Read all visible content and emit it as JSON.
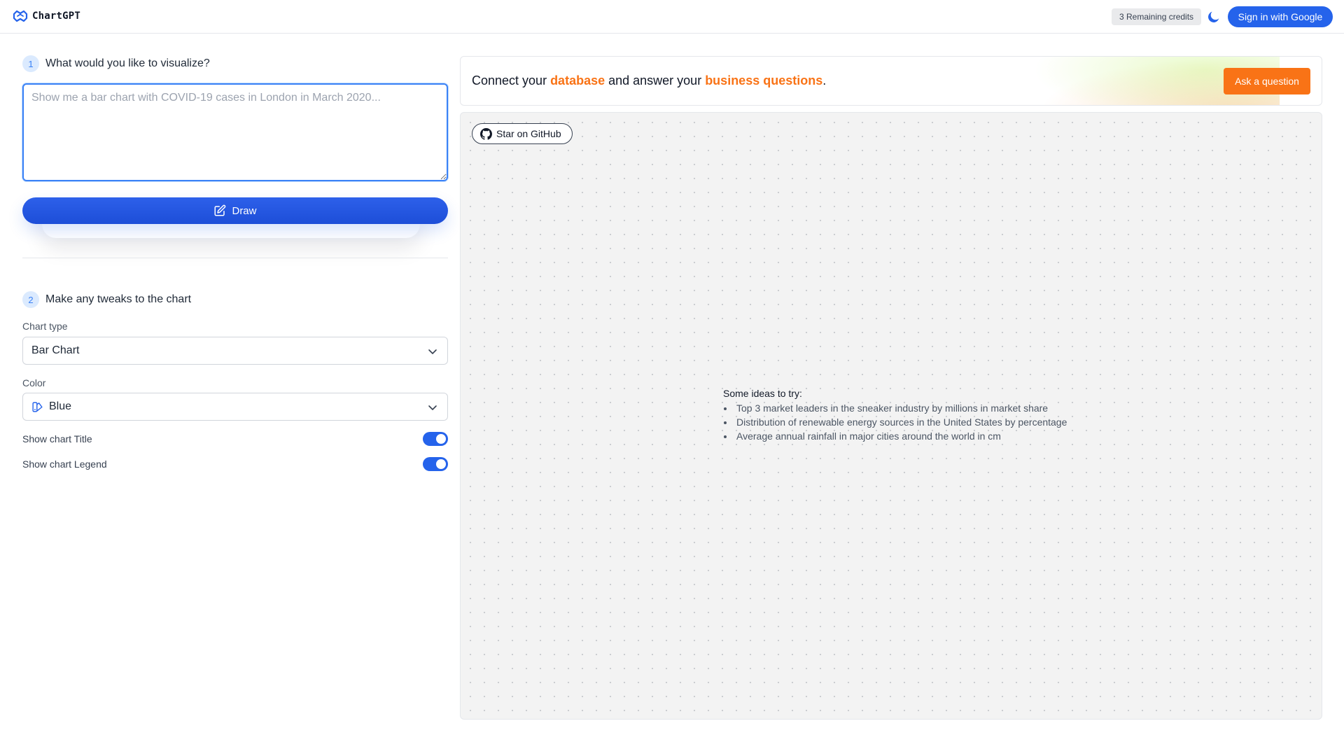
{
  "header": {
    "logo_text": "ChartGPT",
    "credits": "3 Remaining credits",
    "signin_label": "Sign in with Google"
  },
  "step1": {
    "number": "1",
    "title": "What would you like to visualize?",
    "prompt_value": "",
    "prompt_placeholder": "Show me a bar chart with COVID-19 cases in London in March 2020...",
    "draw_label": "Draw"
  },
  "step2": {
    "number": "2",
    "title": "Make any tweaks to the chart",
    "chart_type_label": "Chart type",
    "chart_type_value": "Bar Chart",
    "color_label": "Color",
    "color_value": "Blue",
    "toggles": [
      {
        "label": "Show chart Title",
        "on": true
      },
      {
        "label": "Show chart Legend",
        "on": true
      }
    ]
  },
  "banner": {
    "text_1": "Connect your ",
    "highlight_1": "database",
    "text_2": " and answer your ",
    "highlight_2": "business questions",
    "text_3": ".",
    "ask_label": "Ask a question"
  },
  "canvas": {
    "github_label": "Star on GitHub",
    "ideas_title": "Some ideas to try:",
    "ideas": [
      "Top 3 market leaders in the sneaker industry by millions in market share",
      "Distribution of renewable energy sources in the United States by percentage",
      "Average annual rainfall in major cities around the world in cm"
    ]
  },
  "colors": {
    "primary": "#2563eb",
    "accent": "#f97316",
    "canvas_bg": "#f3f3f3"
  },
  "icons": [
    "chartgpt-logo-icon",
    "moon-icon",
    "edit-icon",
    "palette-icon",
    "chevron-down-icon",
    "github-icon"
  ]
}
